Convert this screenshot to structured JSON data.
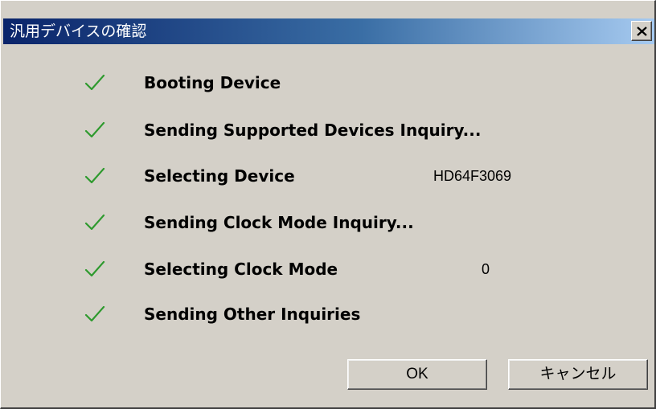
{
  "window": {
    "title": "汎用デバイスの確認",
    "close_label": "×"
  },
  "steps": [
    {
      "label": "Booting Device",
      "value": "",
      "status": "check-icon"
    },
    {
      "label": "Sending Supported Devices Inquiry...",
      "value": "",
      "status": "check-icon"
    },
    {
      "label": "Selecting Device",
      "value": "HD64F3069",
      "status": "check-icon"
    },
    {
      "label": "Sending Clock Mode Inquiry...",
      "value": "",
      "status": "check-icon"
    },
    {
      "label": "Selecting Clock Mode",
      "value": "0",
      "status": "check-icon"
    },
    {
      "label": "Sending Other Inquiries",
      "value": "",
      "status": "check-icon"
    }
  ],
  "buttons": {
    "ok_label": "OK",
    "cancel_label": "キャンセル"
  },
  "colors": {
    "check": "#2e9a2e",
    "title_bar_start": "#0a246a",
    "title_bar_end": "#a6caf0",
    "dialog_bg": "#d4d0c8"
  }
}
